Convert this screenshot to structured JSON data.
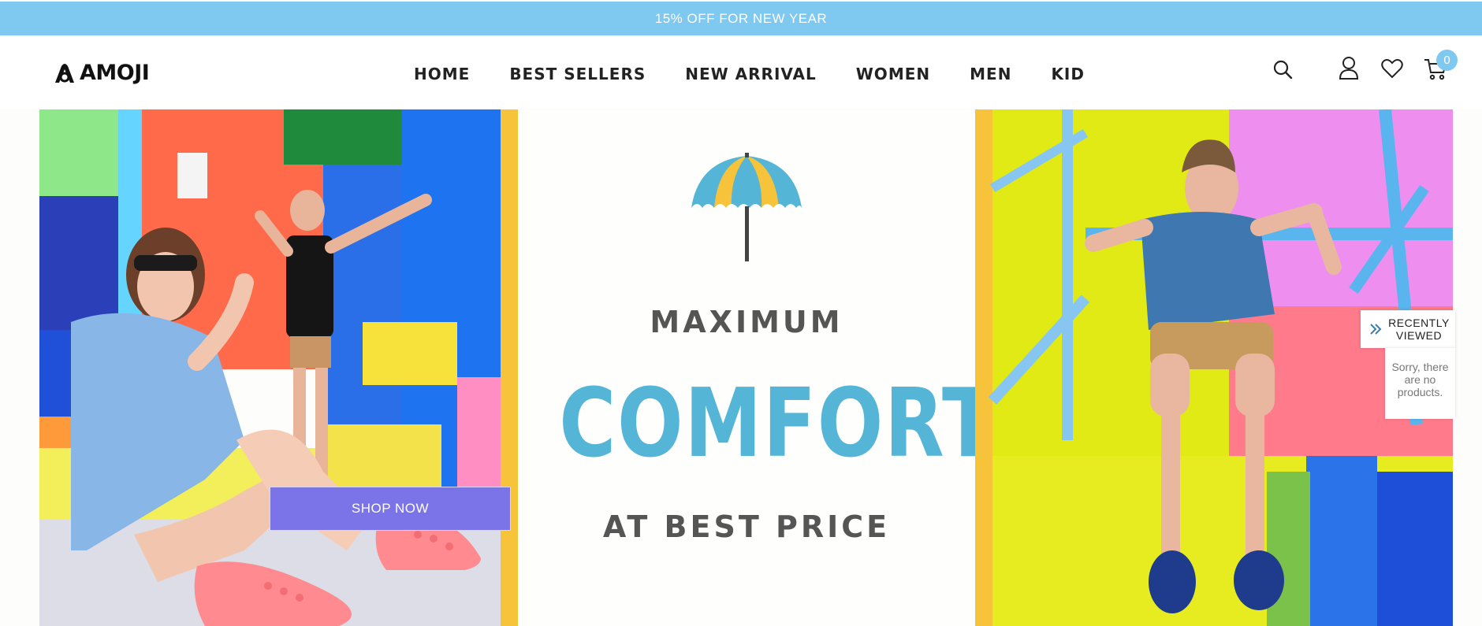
{
  "announcement": "15% OFF FOR NEW YEAR",
  "brand": {
    "name": "AMOJI"
  },
  "nav": [
    {
      "label": "HOME"
    },
    {
      "label": "BEST SELLERS"
    },
    {
      "label": "NEW ARRIVAL"
    },
    {
      "label": "WOMEN"
    },
    {
      "label": "MEN"
    },
    {
      "label": "KID"
    }
  ],
  "header_icons": [
    "search-icon",
    "account-icon",
    "wishlist-heart-icon",
    "cart-icon"
  ],
  "cart": {
    "count": "0"
  },
  "hero": {
    "cta_label": "SHOP NOW",
    "tagline_top": "MAXIMUM",
    "tagline_main": "COMFORT",
    "tagline_bottom": "AT BEST PRICE"
  },
  "recently_viewed": {
    "title": "RECENTLY VIEWED",
    "empty_message": "Sorry, there are no products."
  },
  "colors": {
    "announce_bg": "#7fc8f0",
    "accent_blue": "#54b5d6",
    "cta_purple": "#7b73e8",
    "accent_yellow": "#f6c33b"
  }
}
